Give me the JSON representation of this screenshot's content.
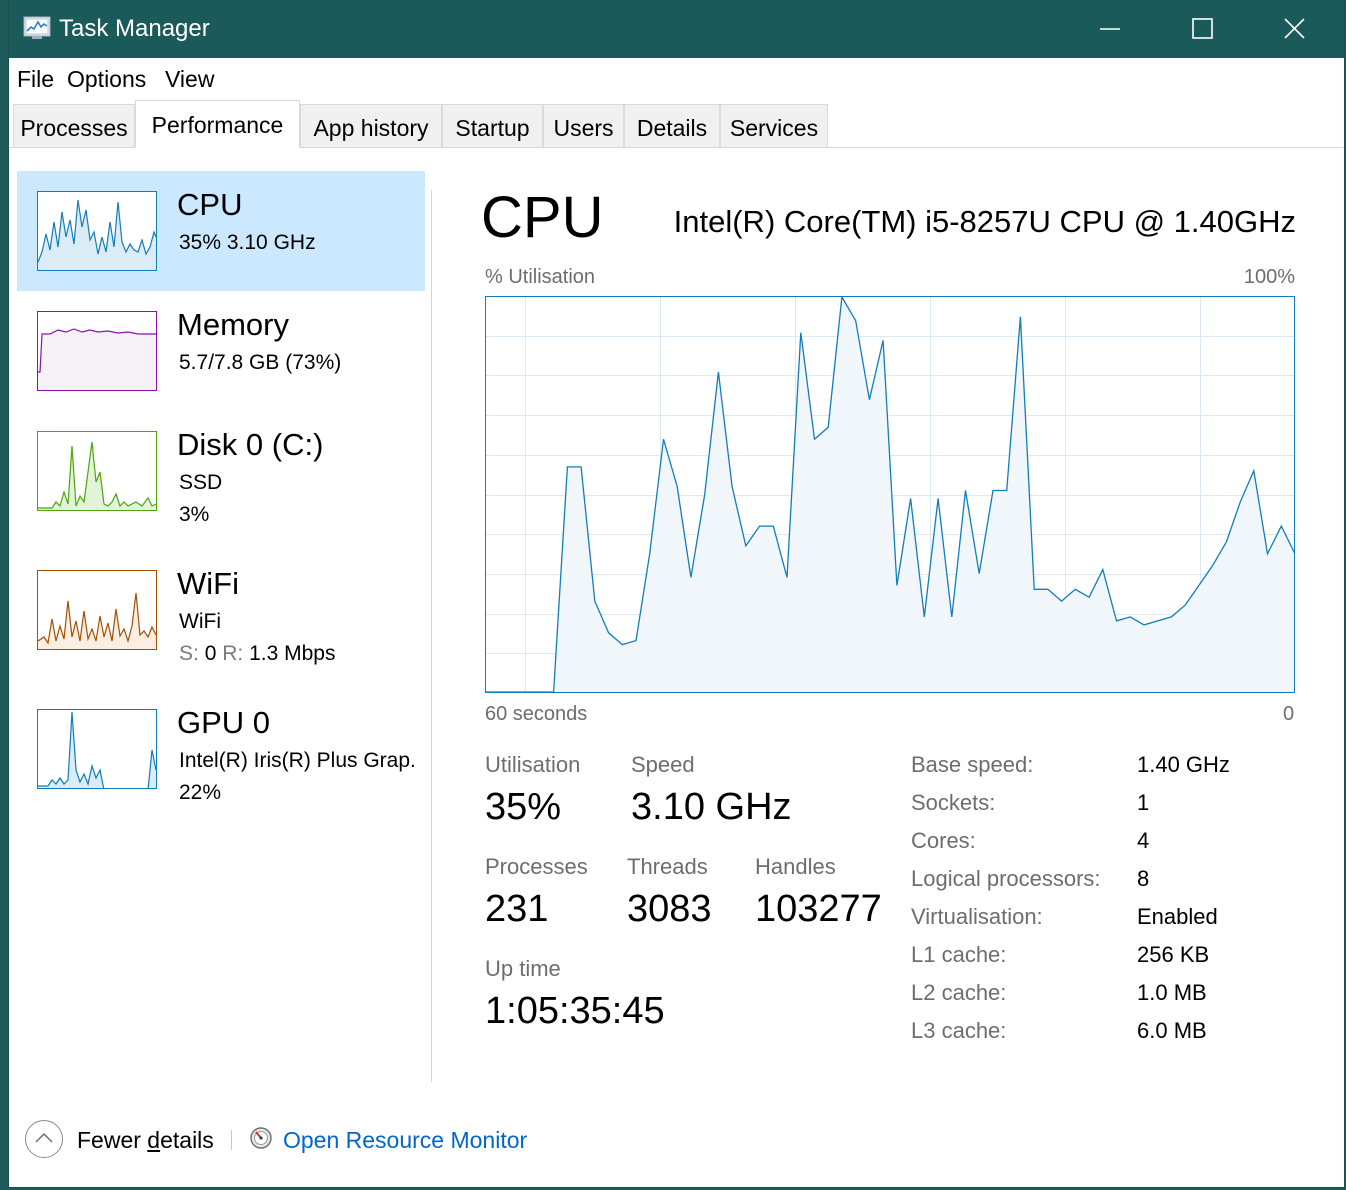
{
  "window": {
    "title": "Task Manager",
    "icons": [
      "task-manager-icon",
      "minimize-icon",
      "maximize-icon",
      "close-icon"
    ]
  },
  "menu": [
    "File",
    "Options",
    "View"
  ],
  "tabs": [
    {
      "label": "Processes",
      "active": false
    },
    {
      "label": "Performance",
      "active": true
    },
    {
      "label": "App history",
      "active": false
    },
    {
      "label": "Startup",
      "active": false
    },
    {
      "label": "Users",
      "active": false
    },
    {
      "label": "Details",
      "active": false
    },
    {
      "label": "Services",
      "active": false
    }
  ],
  "sidebar": [
    {
      "title": "CPU",
      "line1": "35%  3.10 GHz",
      "color": "#117dbb",
      "selected": true
    },
    {
      "title": "Memory",
      "line1": "5.7/7.8 GB (73%)",
      "color": "#8b12ae",
      "selected": false
    },
    {
      "title": "Disk 0 (C:)",
      "line1": "SSD",
      "line2": "3%",
      "color": "#4da60c",
      "selected": false
    },
    {
      "title": "WiFi",
      "line1": "WiFi",
      "send_label": "S:",
      "send_value": "0",
      "recv_label": "R:",
      "recv_value": "1.3 Mbps",
      "color": "#a74f01",
      "selected": false
    },
    {
      "title": "GPU 0",
      "line1": "Intel(R) Iris(R) Plus Grap.",
      "line2": "22%",
      "color": "#117dbb",
      "selected": false
    }
  ],
  "main": {
    "heading": "CPU",
    "model": "Intel(R) Core(TM) i5-8257U CPU @ 1.40GHz",
    "graph": {
      "y_label": "% Utilisation",
      "y_max_label": "100%",
      "x_left_label": "60 seconds",
      "x_right_label": "0",
      "line_color": "#117dbb",
      "fill_color": "#f1f6fa",
      "grid_color": "#d9eaf4",
      "values": [
        0,
        0,
        0,
        0,
        0,
        0,
        57,
        57,
        23,
        15,
        12,
        13,
        35,
        64,
        52,
        29,
        50,
        81,
        52,
        37,
        42,
        42,
        29,
        91,
        64,
        67,
        100,
        94,
        74,
        89,
        27,
        49,
        19,
        49,
        19,
        51,
        30,
        51,
        51,
        95,
        26,
        26,
        23,
        26,
        24,
        31,
        18,
        19,
        17,
        18,
        19,
        22,
        27,
        32,
        38,
        48,
        56,
        35,
        42,
        35
      ]
    },
    "stats": {
      "utilisation_label": "Utilisation",
      "utilisation_value": "35%",
      "speed_label": "Speed",
      "speed_value": "3.10 GHz",
      "processes_label": "Processes",
      "processes_value": "231",
      "threads_label": "Threads",
      "threads_value": "3083",
      "handles_label": "Handles",
      "handles_value": "103277",
      "uptime_label": "Up time",
      "uptime_value": "1:05:35:45"
    },
    "specs": [
      {
        "label": "Base speed:",
        "value": "1.40 GHz"
      },
      {
        "label": "Sockets:",
        "value": "1"
      },
      {
        "label": "Cores:",
        "value": "4"
      },
      {
        "label": "Logical processors:",
        "value": "8"
      },
      {
        "label": "Virtualisation:",
        "value": "Enabled"
      },
      {
        "label": "L1 cache:",
        "value": "256 KB"
      },
      {
        "label": "L2 cache:",
        "value": "1.0 MB"
      },
      {
        "label": "L3 cache:",
        "value": "6.0 MB"
      }
    ]
  },
  "footer": {
    "fewer_prefix": "Fewer ",
    "fewer_underlined": "d",
    "fewer_suffix": "etails",
    "resource_monitor": "Open Resource Monitor"
  }
}
